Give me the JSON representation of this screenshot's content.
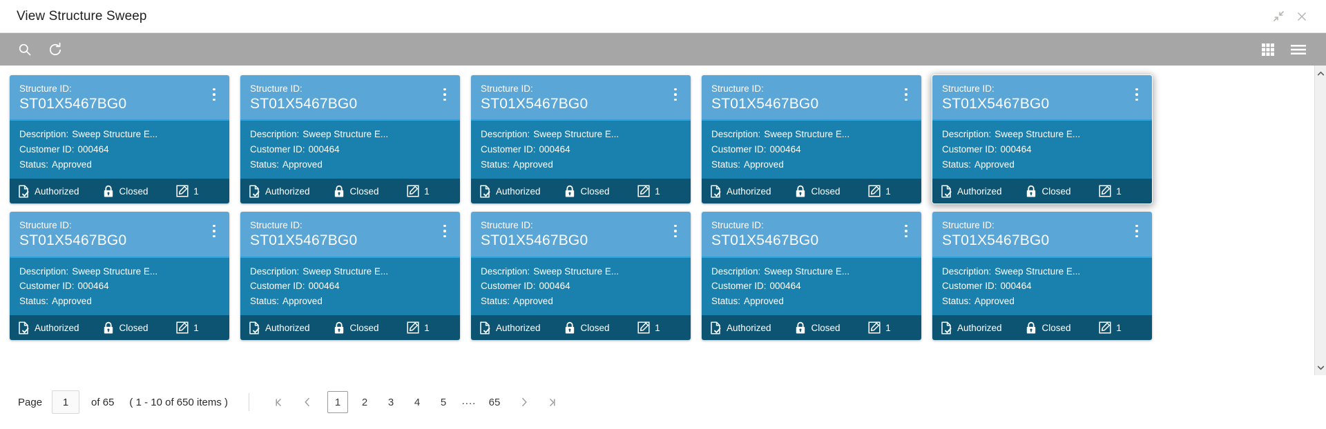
{
  "window": {
    "title": "View Structure Sweep",
    "collapse_icon": "collapse-arrows-icon",
    "close_icon": "close-icon"
  },
  "toolbar": {
    "search_icon": "search-icon",
    "refresh_icon": "refresh-icon",
    "grid_view_icon": "grid-view-icon",
    "list_view_icon": "list-view-icon"
  },
  "card_labels": {
    "structure_id_label": "Structure ID:",
    "description_label": "Description:",
    "customer_id_label": "Customer ID:",
    "status_label": "Status:",
    "menu_icon": "kebab-menu-icon",
    "authorized_icon": "document-check-icon",
    "closed_icon": "padlock-closed-icon",
    "edit_icon": "edit-square-icon"
  },
  "colors": {
    "card_header": "#5aa6d6",
    "card_header_rule": "#29a3dd",
    "card_body": "#1a80ad",
    "card_footer": "#0d5472",
    "toolbar": "#a6a6a6"
  },
  "cards": [
    {
      "structure_id": "ST01X5467BG0",
      "description": "Sweep Structure E...",
      "customer_id": "000464",
      "status": "Approved",
      "authorized": "Authorized",
      "closed": "Closed",
      "edit_count": "1",
      "selected": false
    },
    {
      "structure_id": "ST01X5467BG0",
      "description": "Sweep Structure E...",
      "customer_id": "000464",
      "status": "Approved",
      "authorized": "Authorized",
      "closed": "Closed",
      "edit_count": "1",
      "selected": false
    },
    {
      "structure_id": "ST01X5467BG0",
      "description": "Sweep Structure E...",
      "customer_id": "000464",
      "status": "Approved",
      "authorized": "Authorized",
      "closed": "Closed",
      "edit_count": "1",
      "selected": false
    },
    {
      "structure_id": "ST01X5467BG0",
      "description": "Sweep Structure E...",
      "customer_id": "000464",
      "status": "Approved",
      "authorized": "Authorized",
      "closed": "Closed",
      "edit_count": "1",
      "selected": false
    },
    {
      "structure_id": "ST01X5467BG0",
      "description": "Sweep Structure E...",
      "customer_id": "000464",
      "status": "Approved",
      "authorized": "Authorized",
      "closed": "Closed",
      "edit_count": "1",
      "selected": true
    },
    {
      "structure_id": "ST01X5467BG0",
      "description": "Sweep Structure E...",
      "customer_id": "000464",
      "status": "Approved",
      "authorized": "Authorized",
      "closed": "Closed",
      "edit_count": "1",
      "selected": false
    },
    {
      "structure_id": "ST01X5467BG0",
      "description": "Sweep Structure E...",
      "customer_id": "000464",
      "status": "Approved",
      "authorized": "Authorized",
      "closed": "Closed",
      "edit_count": "1",
      "selected": false
    },
    {
      "structure_id": "ST01X5467BG0",
      "description": "Sweep Structure E...",
      "customer_id": "000464",
      "status": "Approved",
      "authorized": "Authorized",
      "closed": "Closed",
      "edit_count": "1",
      "selected": false
    },
    {
      "structure_id": "ST01X5467BG0",
      "description": "Sweep Structure E...",
      "customer_id": "000464",
      "status": "Approved",
      "authorized": "Authorized",
      "closed": "Closed",
      "edit_count": "1",
      "selected": false
    },
    {
      "structure_id": "ST01X5467BG0",
      "description": "Sweep Structure E...",
      "customer_id": "000464",
      "status": "Approved",
      "authorized": "Authorized",
      "closed": "Closed",
      "edit_count": "1",
      "selected": false
    }
  ],
  "pagination": {
    "page_label": "Page",
    "page_value": "1",
    "of_text": "of 65",
    "items_text": "( 1 - 10 of 650 items )",
    "first_icon": "first-page-icon",
    "prev_icon": "previous-page-icon",
    "next_icon": "next-page-icon",
    "last_icon": "last-page-icon",
    "pages": [
      "1",
      "2",
      "3",
      "4",
      "5"
    ],
    "ellipsis": "....",
    "last_page": "65",
    "active_page": "1"
  },
  "scrollbar": {
    "up_icon": "scroll-up-icon",
    "down_icon": "scroll-down-icon"
  }
}
